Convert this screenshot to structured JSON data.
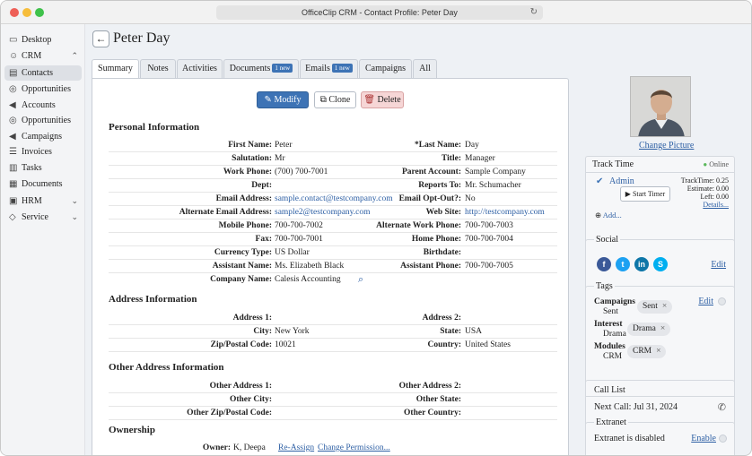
{
  "window": {
    "title": "OfficeClip CRM - Contact Profile: Peter Day"
  },
  "sidebar": {
    "items": [
      {
        "label": "Desktop",
        "icon": "desktop-icon",
        "chev": ""
      },
      {
        "label": "CRM",
        "icon": "people-icon",
        "chev": "^"
      },
      {
        "label": "Contacts",
        "icon": "contacts-icon",
        "chev": ""
      },
      {
        "label": "Opportunities",
        "icon": "money-bag-icon",
        "chev": ""
      },
      {
        "label": "Accounts",
        "icon": "megaphone-icon",
        "chev": ""
      },
      {
        "label": "Opportunities",
        "icon": "money-bag-icon",
        "chev": ""
      },
      {
        "label": "Campaigns",
        "icon": "megaphone-icon",
        "chev": ""
      },
      {
        "label": "Invoices",
        "icon": "invoice-icon",
        "chev": ""
      },
      {
        "label": "Tasks",
        "icon": "tasks-icon",
        "chev": ""
      },
      {
        "label": "Documents",
        "icon": "documents-icon",
        "chev": ""
      },
      {
        "label": "HRM",
        "icon": "briefcase-icon",
        "chev": "v"
      },
      {
        "label": "Service",
        "icon": "shield-icon",
        "chev": "v"
      }
    ]
  },
  "page": {
    "title": "Peter Day"
  },
  "tabs": [
    {
      "label": "Summary",
      "badge": ""
    },
    {
      "label": "Notes",
      "badge": ""
    },
    {
      "label": "Activities",
      "badge": ""
    },
    {
      "label": "Documents",
      "badge": "1 new"
    },
    {
      "label": "Emails",
      "badge": "1 new"
    },
    {
      "label": "Campaigns",
      "badge": ""
    },
    {
      "label": "All",
      "badge": ""
    }
  ],
  "actions": {
    "modify": "Modify",
    "clone": "Clone",
    "delete": "Delete"
  },
  "personal": {
    "heading": "Personal Information",
    "rows": [
      [
        "First Name:",
        "Peter",
        "*Last Name:",
        "Day"
      ],
      [
        "Salutation:",
        "Mr",
        "Title:",
        "Manager"
      ],
      [
        "Work Phone:",
        "(700) 700-7001",
        "Parent Account:",
        "Sample Company"
      ],
      [
        "Dept:",
        "",
        "Reports To:",
        "Mr. Schumacher"
      ],
      [
        "Email Address:",
        "sample.contact@testcompany.com",
        "Email Opt-Out?:",
        "No"
      ],
      [
        "Alternate Email Address:",
        "sample2@testcompany.com",
        "Web Site:",
        "http://testcompany.com"
      ],
      [
        "Mobile Phone:",
        "700-700-7002",
        "Alternate Work Phone:",
        "700-700-7003"
      ],
      [
        "Fax:",
        "700-700-7001",
        "Home Phone:",
        "700-700-7004"
      ],
      [
        "Currency Type:",
        "US Dollar",
        "Birthdate:",
        ""
      ],
      [
        "Assistant Name:",
        "Ms. Elizabeth Black",
        "Assistant Phone:",
        "700-700-7005"
      ]
    ],
    "company_label": "Company Name:",
    "company_value": "Calesis Accounting"
  },
  "address": {
    "heading": "Address Information",
    "rows": [
      [
        "Address 1:",
        "",
        "Address 2:",
        ""
      ],
      [
        "City:",
        "New York",
        "State:",
        "USA"
      ],
      [
        "Zip/Postal Code:",
        "10021",
        "Country:",
        "United States"
      ]
    ]
  },
  "other_address": {
    "heading": "Other Address Information",
    "rows": [
      [
        "Other Address 1:",
        "",
        "Other Address 2:",
        ""
      ],
      [
        "Other City:",
        "",
        "Other State:",
        ""
      ],
      [
        "Other Zip/Postal Code:",
        "",
        "Other Country:",
        ""
      ]
    ]
  },
  "ownership": {
    "heading": "Ownership",
    "owner_label": "Owner:",
    "owner_value": "K, Deepa",
    "reassign": "Re-Assign",
    "change_permission": "Change Permission..."
  },
  "right": {
    "change_picture": "Change Picture",
    "track_time": {
      "title": "Track Time",
      "status": "Online",
      "user": "Admin",
      "start": "Start Timer",
      "tracktime": "TrackTime: 0.25",
      "estimate": "Estimate: 0.00",
      "left": "Left: 0.00",
      "details": "Details...",
      "add": "Add..."
    },
    "social": {
      "title": "Social",
      "edit": "Edit"
    },
    "tags": {
      "title": "Tags",
      "edit": "Edit",
      "groups": [
        {
          "name": "Campaigns",
          "sub": "Sent",
          "tag": "Sent"
        },
        {
          "name": "Interest",
          "sub": "Drama",
          "tag": "Drama"
        },
        {
          "name": "Modules",
          "sub": "CRM",
          "tag": "CRM"
        }
      ]
    },
    "call_list": {
      "title": "Call List",
      "next": "Next Call: Jul 31, 2024"
    },
    "extranet": {
      "title": "Extranet",
      "status": "Extranet is disabled",
      "enable": "Enable"
    }
  },
  "colors": {
    "accent": "#3d73b5",
    "delete_bg": "#f6d6d6",
    "online": "#5cb85c"
  }
}
